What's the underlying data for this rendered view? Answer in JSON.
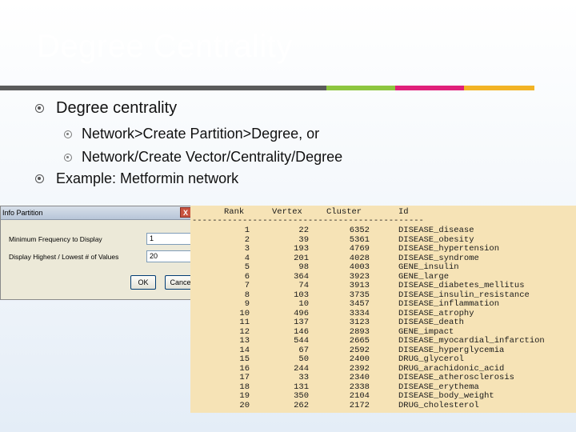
{
  "slide": {
    "title": "Degree Centrality",
    "accent_colors": [
      "#5b5b5b",
      "#8dc63f",
      "#e0207a",
      "#f2b325"
    ]
  },
  "bullets": {
    "main": "Degree centrality",
    "sub1": "Network>Create Partition>Degree, or",
    "sub2": "Network/Create Vector/Centrality/Degree",
    "example": "Example: Metformin network"
  },
  "dialog": {
    "title": "Info Partition",
    "close": "X",
    "field1_label": "Minimum Frequency to Display",
    "field1_value": "1",
    "field2_label": "Display Highest / Lowest # of Values",
    "field2_value": "20",
    "ok_label": "OK",
    "cancel_label": "Cancel"
  },
  "output": {
    "headers": {
      "rank": "Rank",
      "vertex": "Vertex",
      "cluster": "Cluster",
      "id": "Id"
    },
    "separator": "--------------------------------------------------",
    "rows": [
      {
        "rank": "1",
        "vertex": "22",
        "cluster": "6352",
        "id": "DISEASE_disease"
      },
      {
        "rank": "2",
        "vertex": "39",
        "cluster": "5361",
        "id": "DISEASE_obesity"
      },
      {
        "rank": "3",
        "vertex": "193",
        "cluster": "4769",
        "id": "DISEASE_hypertension"
      },
      {
        "rank": "4",
        "vertex": "201",
        "cluster": "4028",
        "id": "DISEASE_syndrome"
      },
      {
        "rank": "5",
        "vertex": "98",
        "cluster": "4003",
        "id": "GENE_insulin"
      },
      {
        "rank": "6",
        "vertex": "364",
        "cluster": "3923",
        "id": "GENE_large"
      },
      {
        "rank": "7",
        "vertex": "74",
        "cluster": "3913",
        "id": "DISEASE_diabetes_mellitus"
      },
      {
        "rank": "8",
        "vertex": "103",
        "cluster": "3735",
        "id": "DISEASE_insulin_resistance"
      },
      {
        "rank": "9",
        "vertex": "10",
        "cluster": "3457",
        "id": "DISEASE_inflammation"
      },
      {
        "rank": "10",
        "vertex": "496",
        "cluster": "3334",
        "id": "DISEASE_atrophy"
      },
      {
        "rank": "11",
        "vertex": "137",
        "cluster": "3123",
        "id": "DISEASE_death"
      },
      {
        "rank": "12",
        "vertex": "146",
        "cluster": "2893",
        "id": "GENE_impact"
      },
      {
        "rank": "13",
        "vertex": "544",
        "cluster": "2665",
        "id": "DISEASE_myocardial_infarction"
      },
      {
        "rank": "14",
        "vertex": "67",
        "cluster": "2592",
        "id": "DISEASE_hyperglycemia"
      },
      {
        "rank": "15",
        "vertex": "50",
        "cluster": "2400",
        "id": "DRUG_glycerol"
      },
      {
        "rank": "16",
        "vertex": "244",
        "cluster": "2392",
        "id": "DRUG_arachidonic_acid"
      },
      {
        "rank": "17",
        "vertex": "33",
        "cluster": "2340",
        "id": "DISEASE_atherosclerosis"
      },
      {
        "rank": "18",
        "vertex": "131",
        "cluster": "2338",
        "id": "DISEASE_erythema"
      },
      {
        "rank": "19",
        "vertex": "350",
        "cluster": "2104",
        "id": "DISEASE_body_weight"
      },
      {
        "rank": "20",
        "vertex": "262",
        "cluster": "2172",
        "id": "DRUG_cholesterol"
      }
    ]
  }
}
